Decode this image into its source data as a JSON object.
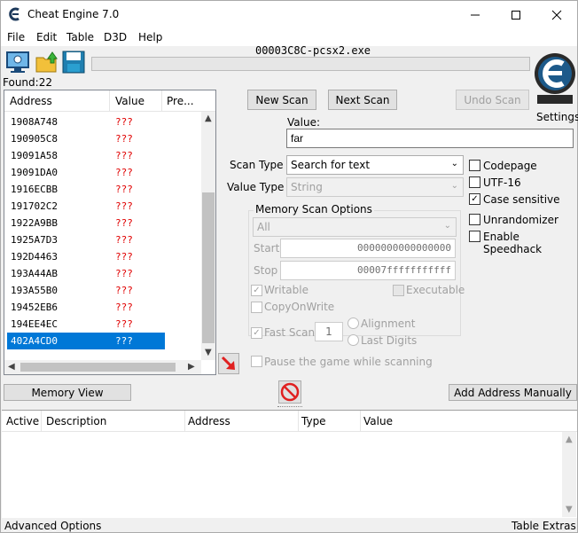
{
  "window": {
    "title": "Cheat Engine 7.0"
  },
  "menu": [
    "File",
    "Edit",
    "Table",
    "D3D",
    "Help"
  ],
  "process_name": "00003C8C-pcsx2.exe",
  "found_label": "Found:22",
  "address_list": {
    "columns": [
      "Address",
      "Value",
      "Pre..."
    ],
    "rows": [
      {
        "address": "1908A748",
        "value": "???"
      },
      {
        "address": "190905C8",
        "value": "???"
      },
      {
        "address": "19091A58",
        "value": "???"
      },
      {
        "address": "19091DA0",
        "value": "???"
      },
      {
        "address": "1916ECBB",
        "value": "???"
      },
      {
        "address": "191702C2",
        "value": "???"
      },
      {
        "address": "1922A9BB",
        "value": "???"
      },
      {
        "address": "1925A7D3",
        "value": "???"
      },
      {
        "address": "192D4463",
        "value": "???"
      },
      {
        "address": "193A44AB",
        "value": "???"
      },
      {
        "address": "193A55B0",
        "value": "???"
      },
      {
        "address": "19452EB6",
        "value": "???"
      },
      {
        "address": "194EE4EC",
        "value": "???"
      },
      {
        "address": "402A4CD0",
        "value": "???"
      }
    ],
    "selected_index": 13
  },
  "buttons": {
    "new_scan": "New Scan",
    "next_scan": "Next Scan",
    "undo_scan": "Undo Scan",
    "memory_view": "Memory View",
    "add_address": "Add Address Manually"
  },
  "settings_label": "Settings",
  "value_label": "Value:",
  "value_input": "far",
  "scan_type": {
    "label": "Scan Type",
    "selected": "Search for text"
  },
  "value_type": {
    "label": "Value Type",
    "selected": "String"
  },
  "memory_scan_options": {
    "title": "Memory Scan Options",
    "region": "All",
    "start_label": "Start",
    "start_value": "0000000000000000",
    "stop_label": "Stop",
    "stop_value": "00007fffffffffff",
    "writable": "Writable",
    "executable": "Executable",
    "copy_on_write": "CopyOnWrite",
    "fast_scan": "Fast Scan",
    "fast_scan_value": "1",
    "alignment": "Alignment",
    "last_digits": "Last Digits",
    "pause_game": "Pause the game while scanning"
  },
  "options": {
    "codepage": "Codepage",
    "utf16": "UTF-16",
    "case_sensitive": "Case sensitive",
    "unrandomizer": "Unrandomizer",
    "speedhack": "Enable Speedhack"
  },
  "cheat_table": {
    "columns": [
      "Active",
      "Description",
      "Address",
      "Type",
      "Value"
    ]
  },
  "status": {
    "left": "Advanced Options",
    "right": "Table Extras"
  }
}
